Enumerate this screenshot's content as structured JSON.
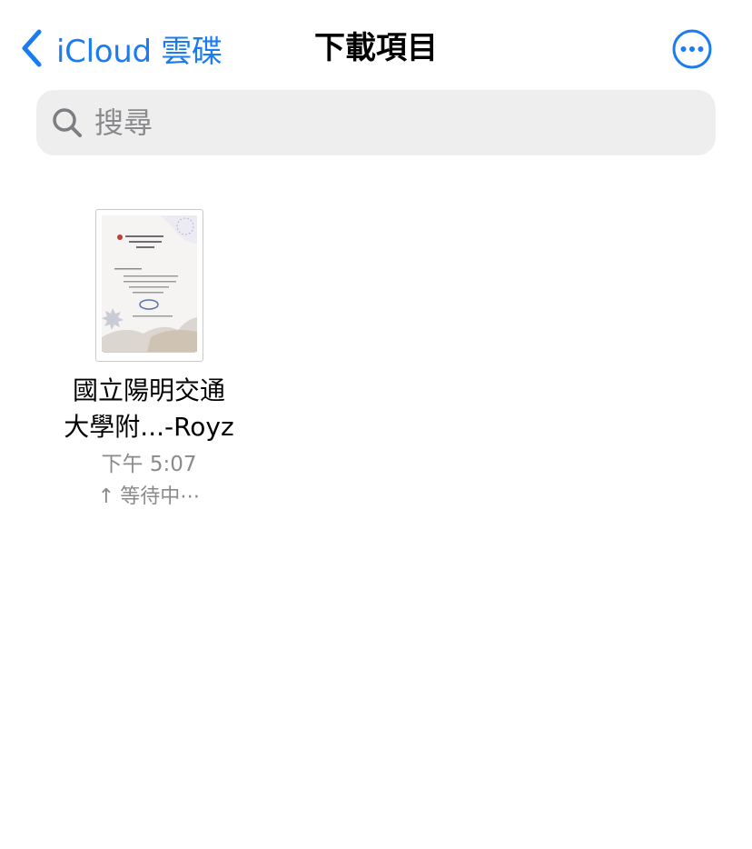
{
  "navbar": {
    "back_label": "iCloud 雲碟",
    "title": "下載項目",
    "more_icon": "ellipsis-circle-icon",
    "back_icon": "chevron-left-icon"
  },
  "search": {
    "placeholder": "搜尋",
    "value": "",
    "icon": "magnifying-glass-icon"
  },
  "files": [
    {
      "name_line1": "國立陽明交通",
      "name_line2": "大學附...-Royz",
      "time": "下午 5:07",
      "status_arrow": "↑",
      "status": "等待中⋯"
    }
  ],
  "colors": {
    "accent": "#1a7cf0",
    "secondary_text": "#8a8a8e",
    "search_background": "#eeeeef"
  }
}
